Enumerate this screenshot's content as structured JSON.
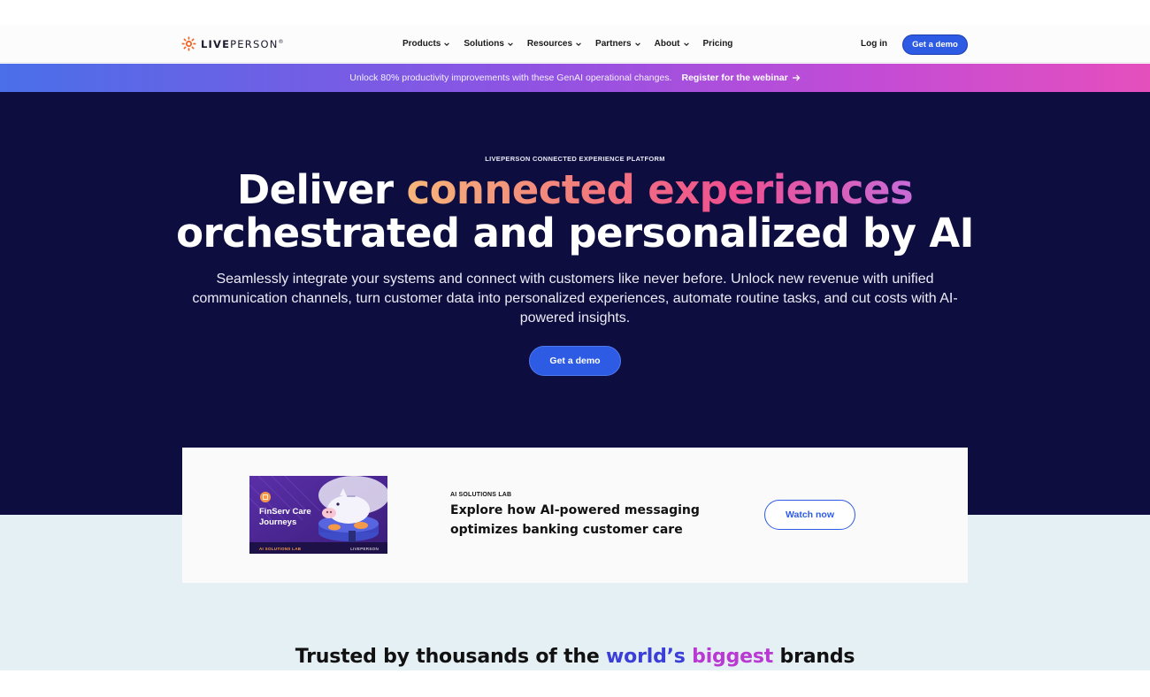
{
  "colors": {
    "accent": "#2d5be3",
    "hero_bg": "#0d0d3f",
    "lower_bg": "#e5f0f5"
  },
  "nav": {
    "logo": {
      "brand_a": "LIVE",
      "brand_b": "PERSON",
      "trademark": "®",
      "icon": "liveperson-logo-icon"
    },
    "menu": [
      {
        "label": "Products",
        "icon": "chevron-down-icon"
      },
      {
        "label": "Solutions",
        "icon": "chevron-down-icon"
      },
      {
        "label": "Resources",
        "icon": "chevron-down-icon"
      },
      {
        "label": "Partners",
        "icon": "chevron-down-icon"
      },
      {
        "label": "About",
        "icon": "chevron-down-icon"
      },
      {
        "label": "Pricing"
      }
    ],
    "login_label": "Log in",
    "cta_label": "Get a demo"
  },
  "banner": {
    "text": "Unlock 80% productivity improvements with these GenAI operational changes.",
    "link_label": "Register for the webinar",
    "link_icon": "arrow-right-icon"
  },
  "hero": {
    "eyebrow": "LIVEPERSON CONNECTED EXPERIENCE PLATFORM",
    "headline": {
      "part1": "Deliver ",
      "highlight": "connected experiences",
      "line2": "orchestrated and personalized by AI"
    },
    "subtext": "Seamlessly integrate your systems and connect with customers like never before. Unlock new revenue with unified communication channels, turn customer data into personalized experiences, automate routine tasks, and cut costs with AI-powered insights.",
    "cta_label": "Get a demo"
  },
  "promo_card": {
    "thumbnail": {
      "title": "FinServ Care Journeys",
      "footer_left": "AI SOLUTIONS LAB",
      "footer_right": "LIVEPERSON",
      "icon": "piggy-bank-icon"
    },
    "eyebrow": "AI SOLUTIONS LAB",
    "title": "Explore how AI-powered messaging optimizes banking customer care",
    "cta_label": "Watch now"
  },
  "trusted": {
    "prefix": "Trusted by thousands of the ",
    "accent1": "world’s",
    "accent2": "biggest",
    "suffix": "brands"
  }
}
